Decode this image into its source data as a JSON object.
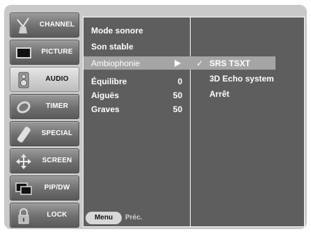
{
  "sidebar": {
    "items": [
      {
        "label": "CHANNEL",
        "icon": "antenna-icon",
        "active": false
      },
      {
        "label": "PICTURE",
        "icon": "tv-screen-icon",
        "active": false
      },
      {
        "label": "AUDIO",
        "icon": "speaker-icon",
        "active": true
      },
      {
        "label": "TIMER",
        "icon": "clock-icon",
        "active": false
      },
      {
        "label": "SPECIAL",
        "icon": "remote-icon",
        "active": false
      },
      {
        "label": "SCREEN",
        "icon": "move-arrows-icon",
        "active": false
      },
      {
        "label": "PIP/DW",
        "icon": "pip-icon",
        "active": false
      },
      {
        "label": "LOCK",
        "icon": "padlock-icon",
        "active": false
      }
    ]
  },
  "menu": {
    "rows": [
      {
        "name": "Mode sonore",
        "value": ""
      },
      {
        "name": "Son stable",
        "value": ""
      },
      {
        "name": "Ambiophonie",
        "value": "",
        "selected": true
      },
      {
        "name": "Équilibre",
        "value": "0"
      },
      {
        "name": "Aiguës",
        "value": "50"
      },
      {
        "name": "Graves",
        "value": "50"
      }
    ]
  },
  "submenu": {
    "options": [
      {
        "label": "SRS TSXT",
        "checked": true,
        "check_mark": "✓"
      },
      {
        "label": "3D Echo system",
        "checked": false,
        "check_mark": ""
      },
      {
        "label": "Arrêt",
        "checked": false,
        "check_mark": ""
      }
    ]
  },
  "footer": {
    "menu_button": "Menu",
    "back_label": "Préc."
  },
  "colors": {
    "frame": "#c9c9c9",
    "panel": "#5e5e5e",
    "selected_row": "#a5a5a5",
    "sidebar_button": "#6f6f6f",
    "sidebar_active": "#cfcfcf"
  }
}
